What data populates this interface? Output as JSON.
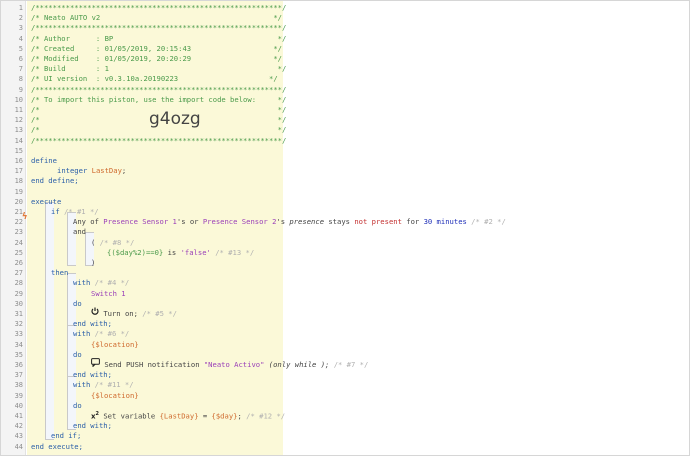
{
  "header": {
    "border": "/*********************************************************/",
    "title": "/* Neato AUTO v2                                        */",
    "author": "/* Author      : BP                                      */",
    "created": "/* Created     : 01/05/2019, 20:15:43                   */",
    "modified": "/* Modified    : 01/05/2019, 20:20:29                   */",
    "build": "/* Build       : 1                                       */",
    "uiversion": "/* UI version  : v0.3.10a.20190223                     */",
    "import_msg": "/* To import this piston, use the import code below:     */",
    "empty": "/*                                                       */",
    "code": "g4ozg"
  },
  "lines": {
    "l16": "define",
    "l17_type": "integer",
    "l17_var": "LastDay",
    "l18": "end define;",
    "l20": "execute",
    "l21_if": "if",
    "l21_c": "/* #1 */",
    "l22": {
      "a": "Any of ",
      "b": "Presence Sensor 1",
      "c": "'s or ",
      "d": "Presence Sensor 2",
      "e": "'s ",
      "f": "presence",
      "g": " stays ",
      "h": "not present",
      "i": " for ",
      "j": "30 minutes",
      "k": " /* #2 */"
    },
    "l23": "and",
    "l24_paren": "(",
    "l24_c": "/* #8 */",
    "l25_expr": "{($day%2)==0}",
    "l25_is": " is ",
    "l25_val": "'false'",
    "l25_c": " /* #13 */",
    "l26": ")",
    "l27": "then",
    "l28_with": "with",
    "l28_c": " /* #4 */",
    "l29": "Switch 1",
    "l30": "do",
    "l31_txt": " Turn on;",
    "l31_c": " /* #5 */",
    "l32": "end with;",
    "l33_with": "with",
    "l33_c": " /* #6 */",
    "l34": "{$location}",
    "l35": "do",
    "l36_a": " Send PUSH notification ",
    "l36_b": "\"Neato Activo\"",
    "l36_c": " (only while );",
    "l36_d": " /* #7 */",
    "l37": "end with;",
    "l38_with": "with",
    "l38_c": " /* #11 */",
    "l39": "{$location}",
    "l40": "do",
    "l41_a": " Set variable ",
    "l41_b": "{LastDay}",
    "l41_c": " = ",
    "l41_d": "{$day}",
    "l41_e": ";",
    "l41_f": " /* #12 */",
    "l42": "end with;",
    "l43": "end if;",
    "l44": "end execute;"
  },
  "line_numbers": [
    "1",
    "2",
    "3",
    "4",
    "5",
    "6",
    "7",
    "8",
    "9",
    "10",
    "11",
    "12",
    "13",
    "14",
    "15",
    "16",
    "17",
    "18",
    "19",
    "20",
    "21",
    "22",
    "23",
    "24",
    "25",
    "26",
    "27",
    "28",
    "29",
    "30",
    "31",
    "32",
    "33",
    "34",
    "35",
    "36",
    "37",
    "38",
    "39",
    "40",
    "41",
    "42",
    "43",
    "44"
  ],
  "icons": {
    "trigger_mark": "lightning-icon",
    "power": "power-icon",
    "chat": "chat-icon",
    "variable": "variable-x2-icon"
  },
  "colors": {
    "comment": "#4a9a4a",
    "keyword": "#2a5ea8",
    "device": "#9a3fb8",
    "variable": "#cf6a2e",
    "header_bg": "#fbf9d8"
  }
}
